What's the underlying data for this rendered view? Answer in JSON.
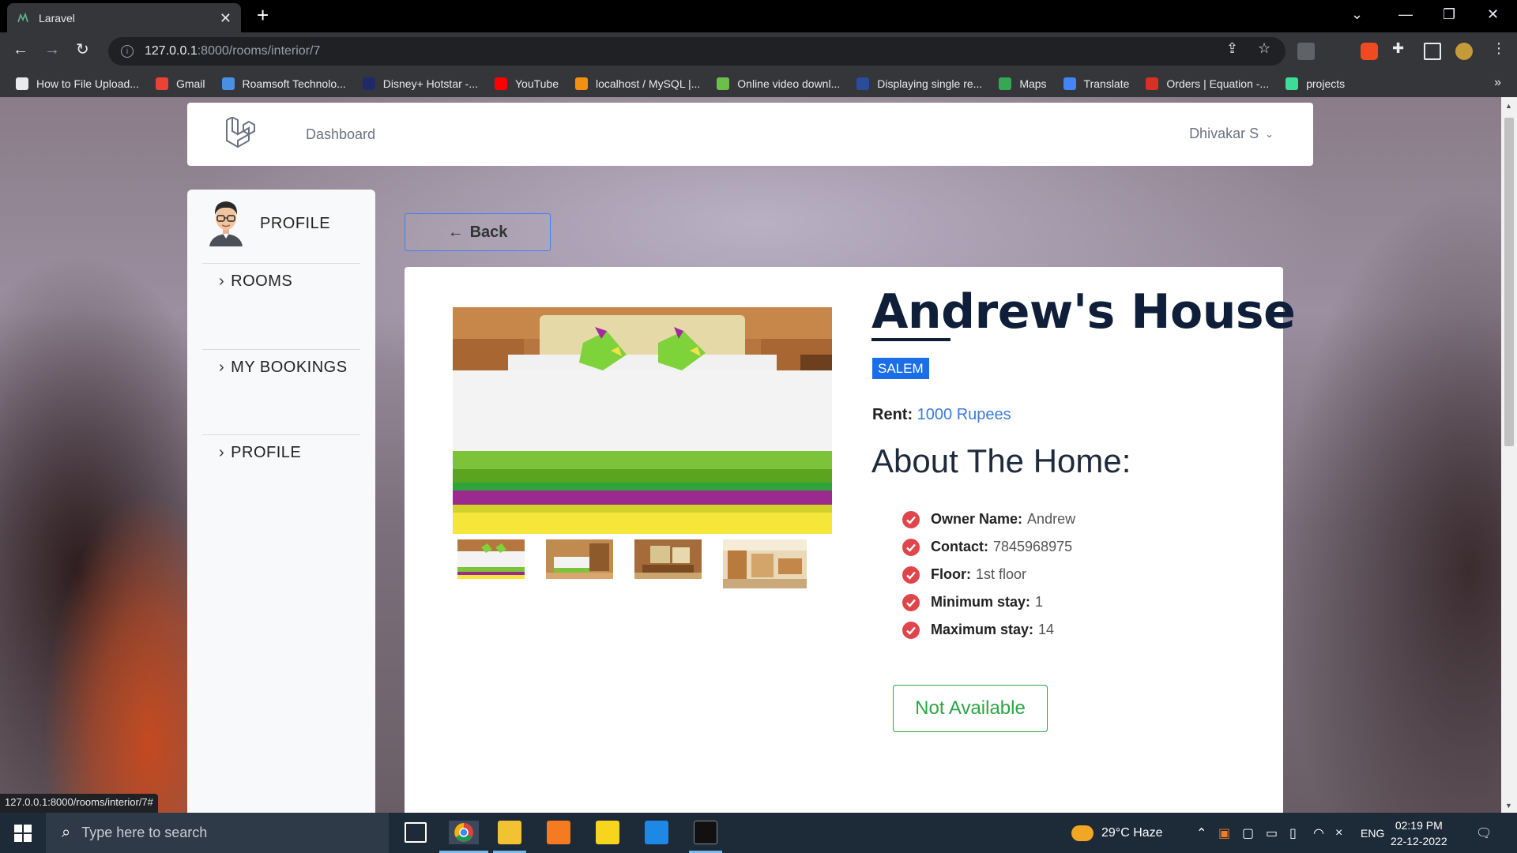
{
  "browser": {
    "tab_title": "Laravel",
    "url_host": "127.0.0.1",
    "url_path": ":8000/rooms/interior/7",
    "status_url": "127.0.0.1:8000/rooms/interior/7#"
  },
  "bookmarks": [
    {
      "label": "How to File Upload...",
      "icon": "bookmark-icon",
      "color": "#e8eaed"
    },
    {
      "label": "Gmail",
      "icon": "gmail-icon",
      "color": "#ea4335"
    },
    {
      "label": "Roamsoft Technolo...",
      "icon": "roamsoft-icon",
      "color": "#4a90e2"
    },
    {
      "label": "Disney+ Hotstar -...",
      "icon": "hotstar-icon",
      "color": "#1f2a6b"
    },
    {
      "label": "YouTube",
      "icon": "youtube-icon",
      "color": "#ff0000"
    },
    {
      "label": "localhost / MySQL |...",
      "icon": "phpmyadmin-icon",
      "color": "#f29111"
    },
    {
      "label": "Online video downl...",
      "icon": "download-icon",
      "color": "#6cc04a"
    },
    {
      "label": "Displaying single re...",
      "icon": "geeks-icon",
      "color": "#2b4c9a"
    },
    {
      "label": "Maps",
      "icon": "maps-icon",
      "color": "#34a853"
    },
    {
      "label": "Translate",
      "icon": "translate-icon",
      "color": "#4285f4"
    },
    {
      "label": "Orders | Equation -...",
      "icon": "equation-icon",
      "color": "#d93025"
    },
    {
      "label": "projects",
      "icon": "projects-icon",
      "color": "#3ddc97"
    }
  ],
  "nav": {
    "dashboard": "Dashboard",
    "user": "Dhivakar S"
  },
  "sidebar": {
    "header": "PROFILE",
    "items": [
      {
        "label": "ROOMS"
      },
      {
        "label": "MY BOOKINGS"
      },
      {
        "label": "PROFILE"
      }
    ]
  },
  "back_label": "Back",
  "room": {
    "title": "Andrew's House",
    "city": "SALEM",
    "rent_label": "Rent:",
    "rent_value": "1000 Rupees",
    "about_heading": "About The Home:",
    "facts": [
      {
        "label": "Owner Name:",
        "value": "Andrew"
      },
      {
        "label": "Contact:",
        "value": "7845968975"
      },
      {
        "label": "Floor:",
        "value": "1st floor"
      },
      {
        "label": "Minimum stay:",
        "value": "1"
      },
      {
        "label": "Maximum stay:",
        "value": "14"
      }
    ],
    "availability": "Not Available"
  },
  "taskbar": {
    "search_placeholder": "Type here to search",
    "weather": "29°C  Haze",
    "lang": "ENG",
    "time": "02:19 PM",
    "date": "22-12-2022"
  },
  "colors": {
    "accent": "#1a6fe8",
    "success": "#28a745",
    "check": "#e0454b"
  }
}
